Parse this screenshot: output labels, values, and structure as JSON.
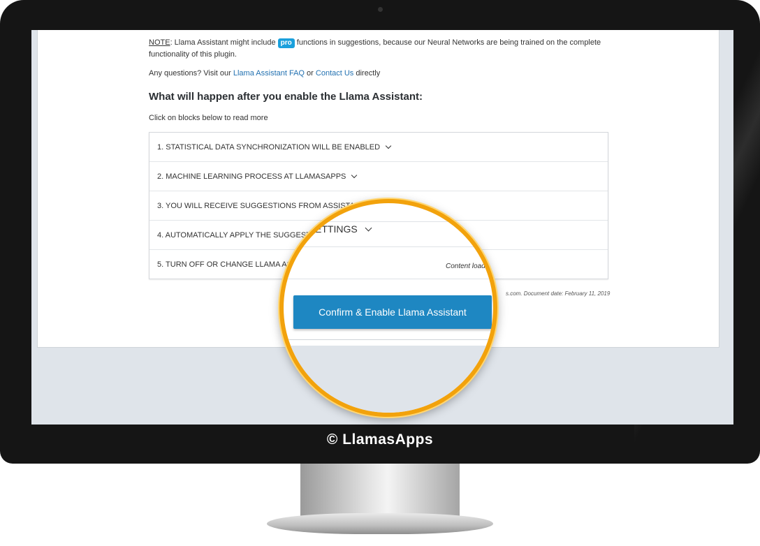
{
  "note": {
    "label": "NOTE",
    "before_badge": ": Llama Assistant might include ",
    "badge": "pro",
    "after_badge": " functions in suggestions, because our Neural Networks are being trained on the complete functionality of this plugin."
  },
  "questions": {
    "prefix": "Any questions? Visit our ",
    "faq_link": "Llama Assistant FAQ",
    "middle": " or ",
    "contact_link": "Contact Us",
    "suffix": " directly"
  },
  "heading": "What will happen after you enable the Llama Assistant:",
  "hint": "Click on blocks below to read more",
  "accordion": {
    "items": [
      {
        "label": "1. STATISTICAL DATA SYNCHRONIZATION WILL BE ENABLED"
      },
      {
        "label": "2. MACHINE LEARNING PROCESS AT LLAMASAPPS"
      },
      {
        "label": "3. YOU WILL RECEIVE SUGGESTIONS FROM ASSISTANT"
      },
      {
        "label": "4. AUTOMATICALLY APPLY THE SUGGESTIO"
      },
      {
        "label": "5. TURN OFF OR CHANGE LLAMA AS"
      }
    ]
  },
  "doc_date": "s.com. Document date: February 11, 2019",
  "magnifier": {
    "settings_fragment": "ETTINGS",
    "content_loaded": "Content load",
    "confirm_button": "Confirm & Enable Llama Assistant"
  },
  "watermark": "© LlamasApps",
  "colors": {
    "accent": "#1e87c2",
    "ring": "#f2a20c",
    "badge": "#1aa0dc"
  }
}
